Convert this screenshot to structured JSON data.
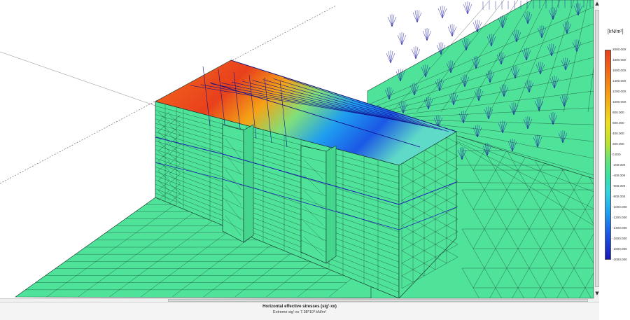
{
  "legend": {
    "unit": "[kN/m²]",
    "ticks": [
      "2000.000",
      "1800.000",
      "1600.000",
      "1400.000",
      "1200.000",
      "1000.000",
      "800.000",
      "600.000",
      "400.000",
      "200.000",
      "0.000",
      "-200.000",
      "-400.000",
      "-600.000",
      "-800.000",
      "-1000.000",
      "-1200.000",
      "-1400.000",
      "-1600.000",
      "-1800.000",
      "-2000.000"
    ]
  },
  "caption": {
    "title": "Horizontal effective stresses (sig'-xx)",
    "extreme": "Extreme sig'-xx 7.38*10³ kN/m²"
  },
  "colors": {
    "soil": "#4fe39a",
    "mesh_line": "#1a3a30",
    "load_arrow": "#1a1aa0",
    "stress_high": "#e8401c",
    "stress_low": "#1818b4"
  }
}
